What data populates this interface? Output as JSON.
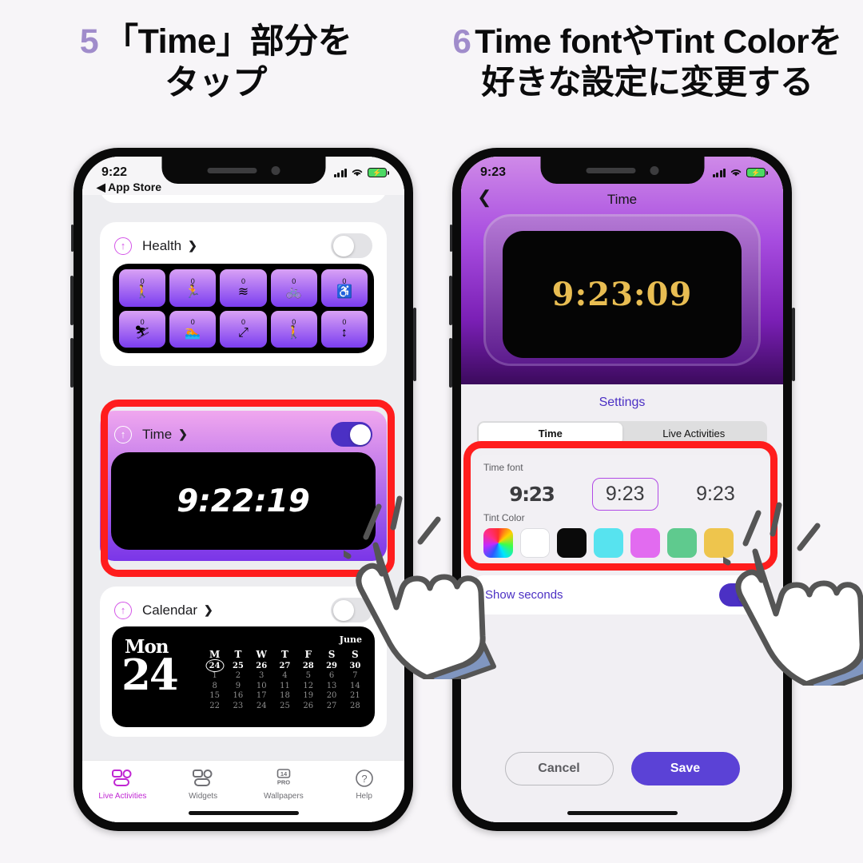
{
  "headings": [
    {
      "number": "5",
      "line1": "「Time」部分を",
      "line2": "タップ",
      "number_color": "#a08ccb"
    },
    {
      "number": "6",
      "line1": "Time fontやTint Colorを",
      "line2": "好きな設定に変更する",
      "number_color": "#a08ccb"
    }
  ],
  "left_phone": {
    "status": {
      "time": "9:22",
      "back_link": "◀ App Store",
      "battery": "⚡",
      "signal": "signal-icon",
      "wifi": "wifi-icon"
    },
    "cards": {
      "health": {
        "label": "Health",
        "chevron": "❯",
        "toggle_on": false,
        "workouts": [
          {
            "count": "0",
            "icon": "🚶",
            "name": "walk-icon"
          },
          {
            "count": "0",
            "icon": "🏃",
            "name": "run-icon"
          },
          {
            "count": "0",
            "icon": "≋",
            "name": "swim-waves-icon"
          },
          {
            "count": "0",
            "icon": "🚲",
            "name": "cycle-icon"
          },
          {
            "count": "0",
            "icon": "♿",
            "name": "wheelchair-run-icon"
          },
          {
            "count": "0",
            "icon": "⛷",
            "name": "ski-icon"
          },
          {
            "count": "0",
            "icon": "🏊",
            "name": "swimmer-icon"
          },
          {
            "count": "0",
            "icon": "⤢",
            "name": "distance-icon"
          },
          {
            "count": "0",
            "icon": "🚶",
            "name": "steps-icon"
          },
          {
            "count": "0",
            "icon": "↕",
            "name": "elevation-icon"
          }
        ]
      },
      "time": {
        "label": "Time",
        "chevron": "❯",
        "toggle_on": true,
        "display": "9:22:19"
      },
      "calendar": {
        "label": "Calendar",
        "chevron": "❯",
        "toggle_on": false,
        "weekday": "Mon",
        "day": "24",
        "month": "June",
        "headers": [
          "M",
          "T",
          "W",
          "T",
          "F",
          "S",
          "S"
        ],
        "weeks": [
          [
            "24",
            "25",
            "26",
            "27",
            "28",
            "29",
            "30"
          ],
          [
            "1",
            "2",
            "3",
            "4",
            "5",
            "6",
            "7"
          ],
          [
            "8",
            "9",
            "10",
            "11",
            "12",
            "13",
            "14"
          ],
          [
            "15",
            "16",
            "17",
            "18",
            "19",
            "20",
            "21"
          ],
          [
            "22",
            "23",
            "24",
            "25",
            "26",
            "27",
            "28"
          ]
        ],
        "selected": "24"
      }
    },
    "tabs": [
      {
        "label": "Live Activities",
        "icon": "live-activities-icon",
        "active": true
      },
      {
        "label": "Widgets",
        "icon": "widgets-icon",
        "active": false
      },
      {
        "label": "Wallpapers",
        "icon": "14pro-icon",
        "active": false,
        "badge": "14\nPRO"
      },
      {
        "label": "Help",
        "icon": "question-circle-icon",
        "active": false
      }
    ]
  },
  "right_phone": {
    "status": {
      "time": "9:23",
      "battery": "⚡"
    },
    "nav": {
      "back": "❮",
      "title": "Time"
    },
    "preview": {
      "clock": "9:23:09",
      "clock_color": "#e8bd52"
    },
    "settings": {
      "title": "Settings",
      "segments": [
        {
          "label": "Time",
          "selected": true
        },
        {
          "label": "Live Activities",
          "selected": false
        }
      ],
      "time_font": {
        "label": "Time font",
        "options": [
          {
            "sample": "9:23",
            "selected": false
          },
          {
            "sample": "9:23",
            "selected": true
          },
          {
            "sample": "9:23",
            "selected": false
          }
        ]
      },
      "tint_color": {
        "label": "Tint Color",
        "swatches": [
          "rainbow",
          "#ffffff",
          "#0a0a0a",
          "#57e3ef",
          "#e26bf0",
          "#5fca8e",
          "#eec54d"
        ],
        "selected_index": 6
      },
      "show_seconds": {
        "label": "Show seconds",
        "toggle_on": true
      },
      "buttons": {
        "cancel": "Cancel",
        "save": "Save"
      }
    }
  },
  "accents": {
    "red_highlight": "#ff1d1d",
    "purple": "#4b30c4",
    "magenta": "#c026d3"
  }
}
